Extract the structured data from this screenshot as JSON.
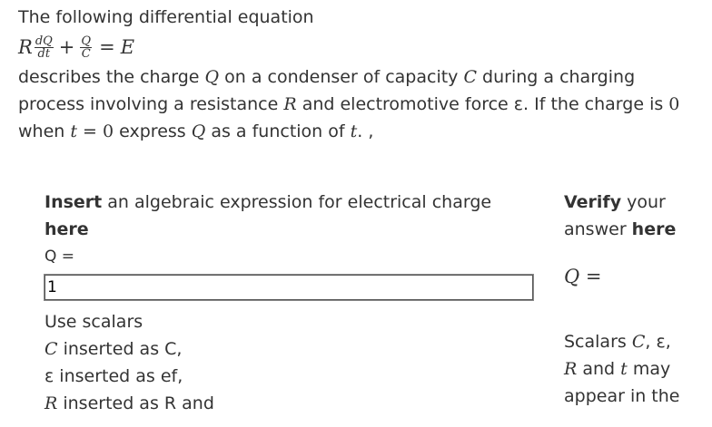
{
  "question": {
    "intro": "The following differential equation",
    "equation": {
      "R": "R",
      "dQ": "dQ",
      "dt": "dt",
      "plus": "+",
      "Q": "Q",
      "C": "C",
      "equals": "=",
      "E": "E"
    },
    "line1": {
      "a": "describes the charge ",
      "Q": "Q",
      "b": " on a condenser of capacity ",
      "C": "C",
      "c": " during a charging"
    },
    "line2": {
      "a": "process involving a resistance ",
      "R": "R",
      "b": " and electromotive force ε. If the charge is ",
      "zero": "0"
    },
    "line3": {
      "a": "when ",
      "t": "t",
      "eq": " = ",
      "zero": "0",
      "b": " express ",
      "Q": "Q",
      "c": " as a function of ",
      "t2": "t",
      "d": ". ,"
    }
  },
  "input_panel": {
    "title_bold": "Insert",
    "title_rest": " an algebraic expression for electrical charge",
    "title_bold2": "here",
    "label": "Q =",
    "value": "1",
    "scalars_heading": "Use scalars",
    "scalar1": {
      "sym": "C",
      "text": " inserted as C,"
    },
    "scalar2": {
      "text": "ε inserted as ef,"
    },
    "scalar3": {
      "sym": "R",
      "text": " inserted as R and"
    }
  },
  "verify_panel": {
    "title_bold": "Verify",
    "title_rest": " your",
    "title_line2": "answer ",
    "title_bold2": "here",
    "preview_Q": "Q",
    "preview_eq": " =",
    "scalars_line1": "Scalars ",
    "scalars_C": "C",
    "scalars_eps": ", ε,",
    "scalars_R": "R",
    "scalars_and": " and ",
    "scalars_t": "t",
    "scalars_may": " may",
    "scalars_line3": "appear in the"
  }
}
